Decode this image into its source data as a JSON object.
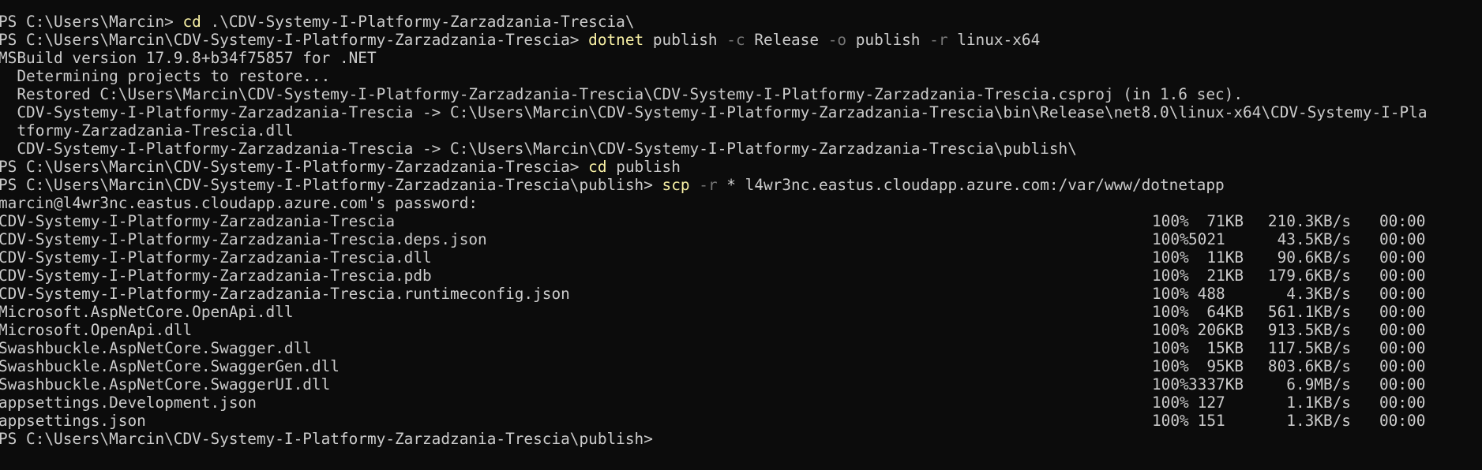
{
  "terminal": {
    "background": "#0c0c0c",
    "foreground": "#cccccc",
    "command_color": "#f9f1a5",
    "parameter_color": "#767676",
    "lines_before": [
      {
        "kind": "prompt",
        "prompt": "PS C:\\Users\\Marcin> ",
        "cmd": "cd",
        "rest": " .\\CDV-Systemy-I-Platformy-Zarzadzania-Trescia\\"
      },
      {
        "kind": "prompt_publish",
        "prompt": "PS C:\\Users\\Marcin\\CDV-Systemy-I-Platformy-Zarzadzania-Trescia> ",
        "cmd": "dotnet",
        "a1": " publish ",
        "p1": "-c",
        "a2": " Release ",
        "p2": "-o",
        "a3": " publish ",
        "p3": "-r",
        "a4": " linux-x64"
      },
      {
        "kind": "text",
        "text": "MSBuild version 17.9.8+b34f75857 for .NET"
      },
      {
        "kind": "text",
        "text": "  Determining projects to restore..."
      },
      {
        "kind": "text",
        "text": "  Restored C:\\Users\\Marcin\\CDV-Systemy-I-Platformy-Zarzadzania-Trescia\\CDV-Systemy-I-Platformy-Zarzadzania-Trescia.csproj (in 1.6 sec)."
      },
      {
        "kind": "text",
        "text": "  CDV-Systemy-I-Platformy-Zarzadzania-Trescia -> C:\\Users\\Marcin\\CDV-Systemy-I-Platformy-Zarzadzania-Trescia\\bin\\Release\\net8.0\\linux-x64\\CDV-Systemy-I-Pla"
      },
      {
        "kind": "text",
        "text": "  tformy-Zarzadzania-Trescia.dll"
      },
      {
        "kind": "text",
        "text": "  CDV-Systemy-I-Platformy-Zarzadzania-Trescia -> C:\\Users\\Marcin\\CDV-Systemy-I-Platformy-Zarzadzania-Trescia\\publish\\"
      },
      {
        "kind": "prompt",
        "prompt": "PS C:\\Users\\Marcin\\CDV-Systemy-I-Platformy-Zarzadzania-Trescia> ",
        "cmd": "cd",
        "rest": " publish"
      },
      {
        "kind": "prompt_scp",
        "prompt": "PS C:\\Users\\Marcin\\CDV-Systemy-I-Platformy-Zarzadzania-Trescia\\publish> ",
        "cmd": "scp",
        "a1": " ",
        "p1": "-r",
        "a2": " * l4wr3nc.eastus.cloudapp.azure.com:/var/www/dotnetapp"
      },
      {
        "kind": "text",
        "text": "marcin@l4wr3nc.eastus.cloudapp.azure.com's password:"
      }
    ],
    "transfers": [
      {
        "name": "CDV-Systemy-I-Platformy-Zarzadzania-Trescia",
        "percent": "100%",
        "size": "  71KB",
        "rate": "210.3KB/s",
        "time": "00:00"
      },
      {
        "name": "CDV-Systemy-I-Platformy-Zarzadzania-Trescia.deps.json",
        "percent": "100%",
        "size": "5021",
        "rate": "43.5KB/s",
        "time": "00:00"
      },
      {
        "name": "CDV-Systemy-I-Platformy-Zarzadzania-Trescia.dll",
        "percent": "100%",
        "size": "  11KB",
        "rate": "90.6KB/s",
        "time": "00:00"
      },
      {
        "name": "CDV-Systemy-I-Platformy-Zarzadzania-Trescia.pdb",
        "percent": "100%",
        "size": "  21KB",
        "rate": "179.6KB/s",
        "time": "00:00"
      },
      {
        "name": "CDV-Systemy-I-Platformy-Zarzadzania-Trescia.runtimeconfig.json",
        "percent": "100%",
        "size": " 488",
        "rate": "4.3KB/s",
        "time": "00:00"
      },
      {
        "name": "Microsoft.AspNetCore.OpenApi.dll",
        "percent": "100%",
        "size": "  64KB",
        "rate": "561.1KB/s",
        "time": "00:00"
      },
      {
        "name": "Microsoft.OpenApi.dll",
        "percent": "100%",
        "size": " 206KB",
        "rate": "913.5KB/s",
        "time": "00:00"
      },
      {
        "name": "Swashbuckle.AspNetCore.Swagger.dll",
        "percent": "100%",
        "size": "  15KB",
        "rate": "117.5KB/s",
        "time": "00:00"
      },
      {
        "name": "Swashbuckle.AspNetCore.SwaggerGen.dll",
        "percent": "100%",
        "size": "  95KB",
        "rate": "803.6KB/s",
        "time": "00:00"
      },
      {
        "name": "Swashbuckle.AspNetCore.SwaggerUI.dll",
        "percent": "100%",
        "size": "3337KB",
        "rate": "6.9MB/s",
        "time": "00:00"
      },
      {
        "name": "appsettings.Development.json",
        "percent": "100%",
        "size": " 127",
        "rate": "1.1KB/s",
        "time": "00:00"
      },
      {
        "name": "appsettings.json",
        "percent": "100%",
        "size": " 151",
        "rate": "1.3KB/s",
        "time": "00:00"
      }
    ],
    "final_prompt": "PS C:\\Users\\Marcin\\CDV-Systemy-I-Platformy-Zarzadzania-Trescia\\publish>"
  }
}
